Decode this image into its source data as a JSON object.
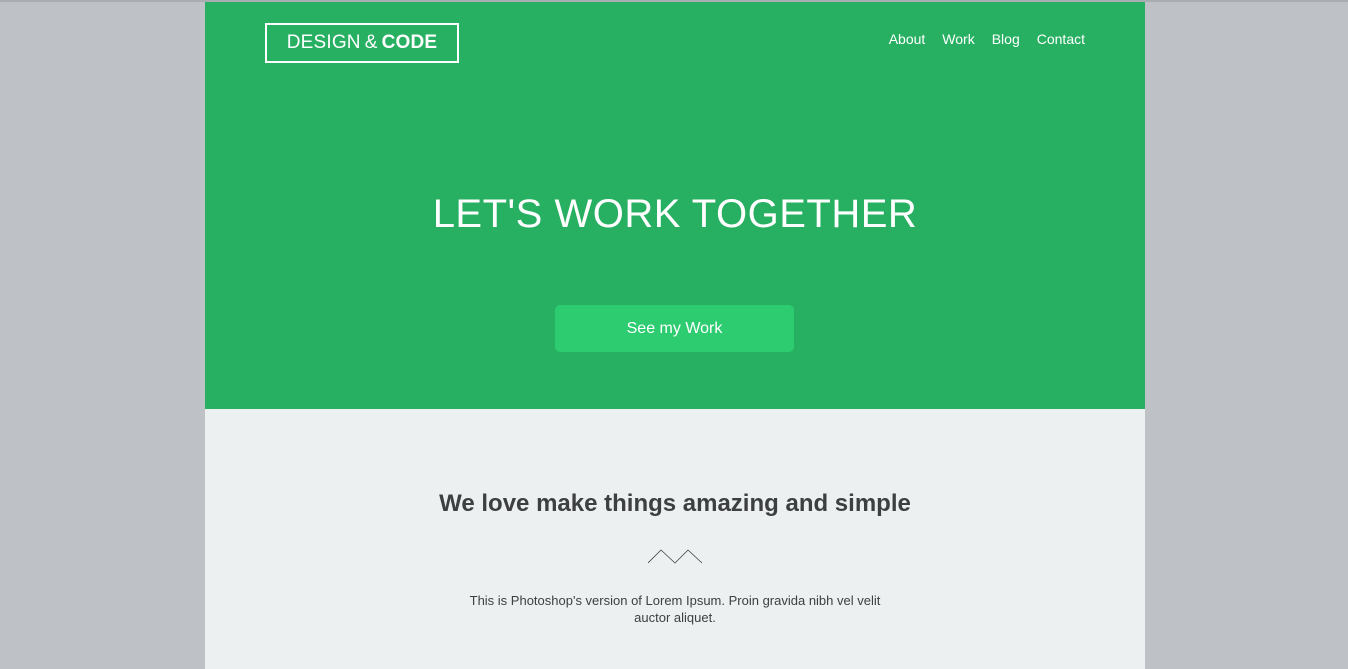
{
  "colors": {
    "hero_bg": "#28b062",
    "button_bg": "#2ecc71",
    "content_bg": "#ecf0f1",
    "outer_bg": "#bec2c6",
    "text_dark": "#3d3f40",
    "text_light": "#ffffff"
  },
  "logo": {
    "part1": "DESIGN",
    "amp": "&",
    "part2": "CODE"
  },
  "nav": {
    "items": [
      {
        "label": "About"
      },
      {
        "label": "Work"
      },
      {
        "label": "Blog"
      },
      {
        "label": "Contact"
      }
    ]
  },
  "hero": {
    "title": "LET'S WORK TOGETHER",
    "button_label": "See my Work"
  },
  "intro": {
    "title": "We love make things amazing and simple",
    "divider_icon": "zigzag-icon",
    "text": "This is Photoshop's version of Lorem Ipsum. Proin gravida nibh vel velit auctor aliquet."
  }
}
